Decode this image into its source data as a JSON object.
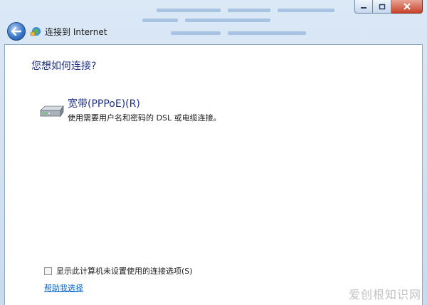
{
  "navbar": {
    "title": "连接到 Internet",
    "back_icon": "back-arrow-icon",
    "app_icon": "network-globe-icon"
  },
  "window_controls": {
    "minimize_icon": "minimize-icon",
    "maximize_icon": "maximize-icon",
    "close_icon": "close-icon"
  },
  "content": {
    "question": "您想如何连接?",
    "options": [
      {
        "title": "宽带(PPPoE)(R)",
        "description": "使用需要用户名和密码的 DSL 或电缆连接。",
        "icon": "modem-icon"
      }
    ],
    "checkbox": {
      "label": "显示此计算机未设置使用的连接选项(S)",
      "checked": false
    },
    "help_link": "帮助我选择"
  },
  "watermark": "爱创根知识网",
  "colors": {
    "heading": "#1e3287",
    "link": "#0066cc",
    "frame": "#c9dcef"
  }
}
